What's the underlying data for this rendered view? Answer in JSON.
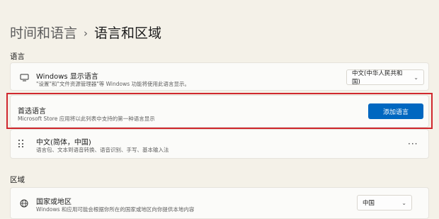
{
  "breadcrumb": {
    "parent": "时间和语言",
    "separator": "›",
    "current": "语言和区域"
  },
  "sections": {
    "language": "语言",
    "region": "区域"
  },
  "display_language": {
    "title": "Windows 显示语言",
    "desc": "\"设置\"和\"文件资源管理器\"等 Windows 功能将使用此语言显示。",
    "value": "中文(中华人民共和国)",
    "icon": "monitor-icon"
  },
  "preferred_language": {
    "title": "首选语言",
    "desc": "Microsoft Store 应用将以此列表中支持的第一种语言显示",
    "button": "添加语言"
  },
  "language_item": {
    "title": "中文(简体，中国)",
    "desc": "语言包、文本到语音转换、语音识别、手写、基本输入法",
    "more": "···",
    "icon": "drag-handle-icon"
  },
  "country_region": {
    "title": "国家或地区",
    "desc": "Windows 和应用可能会根据你所在的国家或地区向你提供本地内容",
    "value": "中国",
    "icon": "globe-icon"
  },
  "colors": {
    "accent": "#0067c0",
    "highlight": "#d0282e",
    "background": "#f4f1e8"
  }
}
